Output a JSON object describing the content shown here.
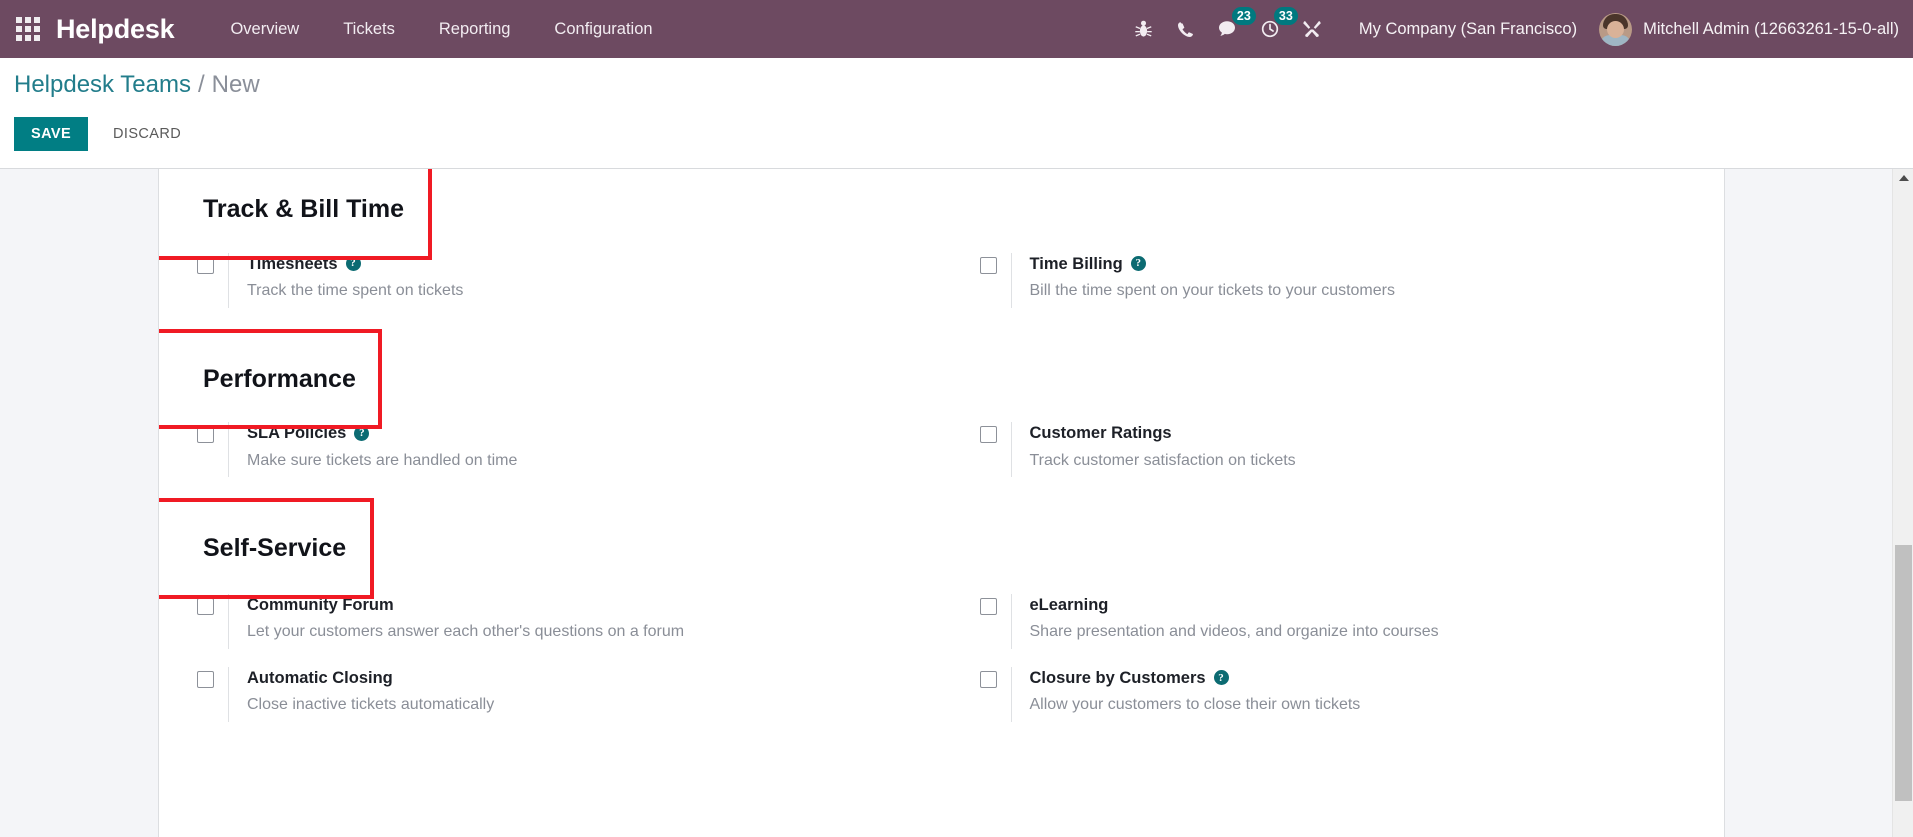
{
  "navbar": {
    "apps_icon": "apps-grid-icon",
    "brand": "Helpdesk",
    "menu": [
      {
        "label": "Overview"
      },
      {
        "label": "Tickets"
      },
      {
        "label": "Reporting"
      },
      {
        "label": "Configuration"
      }
    ],
    "system_icons": [
      {
        "name": "bug-icon",
        "badge": null
      },
      {
        "name": "phone-icon",
        "badge": null
      },
      {
        "name": "messages-icon",
        "badge": "23"
      },
      {
        "name": "activities-clock-icon",
        "badge": "33"
      },
      {
        "name": "wrench-icon",
        "badge": null
      }
    ],
    "company": "My Company (San Francisco)",
    "user": "Mitchell Admin (12663261-15-0-all)",
    "accent_purple": "#6d4a61",
    "badge_color": "#00797f"
  },
  "control_panel": {
    "breadcrumb_root": "Helpdesk Teams",
    "breadcrumb_separator": "/",
    "breadcrumb_current": "New",
    "save_label": "SAVE",
    "discard_label": "DISCARD",
    "save_color": "#017e84"
  },
  "annotation": {
    "color": "#f01a24",
    "targets": [
      "Track & Bill Time",
      "Performance",
      "Self-Service"
    ]
  },
  "settings": {
    "sections": [
      {
        "title": "Track & Bill Time",
        "annotated": true,
        "rows": [
          {
            "left": {
              "label": "Timesheets",
              "help": true,
              "help_glyph": "?",
              "description": "Track the time spent on tickets",
              "checked": false
            },
            "right": {
              "label": "Time Billing",
              "help": true,
              "help_glyph": "?",
              "description": "Bill the time spent on your tickets to your customers",
              "checked": false
            }
          }
        ]
      },
      {
        "title": "Performance",
        "annotated": true,
        "rows": [
          {
            "left": {
              "label": "SLA Policies",
              "help": true,
              "help_glyph": "?",
              "description": "Make sure tickets are handled on time",
              "checked": false
            },
            "right": {
              "label": "Customer Ratings",
              "help": false,
              "help_glyph": "",
              "description": "Track customer satisfaction on tickets",
              "checked": false
            }
          }
        ]
      },
      {
        "title": "Self-Service",
        "annotated": true,
        "rows": [
          {
            "left": {
              "label": "Community Forum",
              "help": false,
              "help_glyph": "",
              "description": "Let your customers answer each other's questions on a forum",
              "checked": false
            },
            "right": {
              "label": "eLearning",
              "help": false,
              "help_glyph": "",
              "description": "Share presentation and videos, and organize into courses",
              "checked": false
            }
          },
          {
            "left": {
              "label": "Automatic Closing",
              "help": false,
              "help_glyph": "",
              "description": "Close inactive tickets automatically",
              "checked": false
            },
            "right": {
              "label": "Closure by Customers",
              "help": true,
              "help_glyph": "?",
              "description": "Allow your customers to close their own tickets",
              "checked": false
            }
          }
        ]
      }
    ]
  },
  "scrollbar": {
    "up_arrow_icon": "caret-up-icon",
    "thumb_name": "vertical-scroll-thumb"
  }
}
